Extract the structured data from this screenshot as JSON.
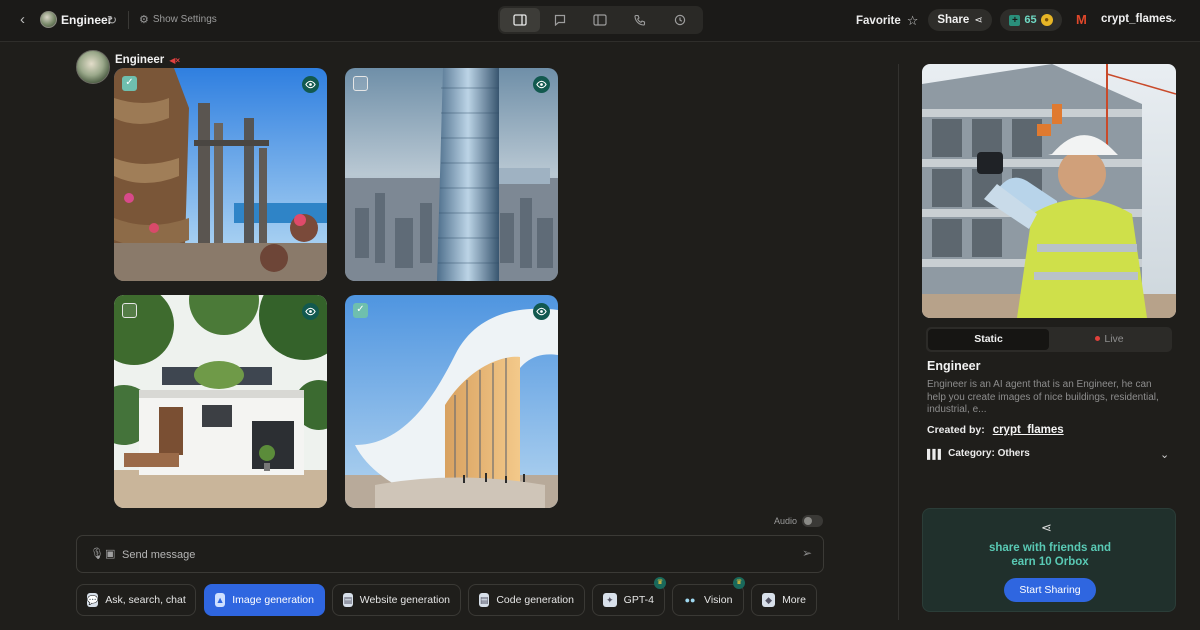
{
  "header": {
    "bot_name": "Engineer",
    "settings_label": "Show Settings",
    "favorite_label": "Favorite",
    "share_label": "Share",
    "credits": "65",
    "username": "crypt_flames",
    "view_buttons": [
      "layout-icon",
      "chat-icon",
      "sidebar-icon",
      "phone-icon",
      "history-icon"
    ]
  },
  "chat": {
    "agent_name": "Engineer",
    "images": [
      {
        "subject": "ornate cliffside building with towers and flowers",
        "checked": true
      },
      {
        "subject": "tall cylindrical skyscraper over city",
        "checked": false
      },
      {
        "subject": "modern white house with green roof",
        "checked": false
      },
      {
        "subject": "curved white futuristic building",
        "checked": true
      }
    ],
    "audio_label": "Audio",
    "input_placeholder": "Send message",
    "tools": [
      {
        "label": "Ask, search, chat",
        "active": false
      },
      {
        "label": "Image generation",
        "active": true
      },
      {
        "label": "Website generation",
        "active": false
      },
      {
        "label": "Code generation",
        "active": false
      },
      {
        "label": "GPT-4",
        "active": false,
        "premium": true
      },
      {
        "label": "Vision",
        "active": false,
        "premium": true
      },
      {
        "label": "More",
        "active": false
      }
    ]
  },
  "agent_panel": {
    "tabs": {
      "static": "Static",
      "live": "Live"
    },
    "title": "Engineer",
    "description": "Engineer is an AI agent that is an Engineer, he can help you create images of nice buildings, residential, industrial, e...",
    "created_by_label": "Created by:",
    "creator": "crypt_flames",
    "category_label": "Category: Others",
    "promo_line1": "share with friends and",
    "promo_line2": "earn 10 Orbox",
    "promo_button": "Start Sharing"
  },
  "colors": {
    "accent_blue": "#2f66e0",
    "teal": "#59c9b4",
    "background": "#1f1e1b"
  }
}
